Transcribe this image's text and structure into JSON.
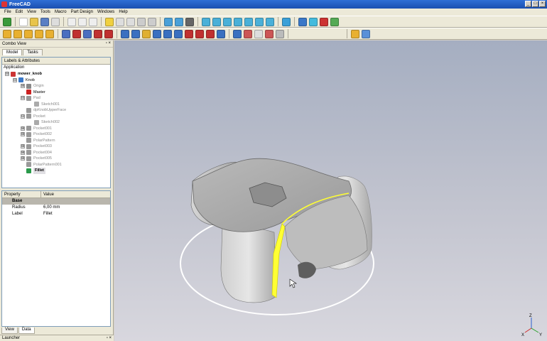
{
  "window": {
    "title": "FreeCAD",
    "buttons": [
      "_",
      "□",
      "×"
    ]
  },
  "menu": [
    "File",
    "Edit",
    "View",
    "Tools",
    "Macro",
    "Part Design",
    "Windows",
    "Help"
  ],
  "combo_view": {
    "title": "Combo View",
    "dock_buttons": "▫ ×",
    "tabs": [
      "Model",
      "Tasks"
    ],
    "labels_header": "Labels & Attributes",
    "section": "Application",
    "tree": [
      {
        "label": "mower_knob",
        "indent": 0,
        "expander": "⊟",
        "style": "bold",
        "icon_color": "#cc3333"
      },
      {
        "label": "Knob",
        "indent": 1,
        "expander": "⊟",
        "style": "normal",
        "icon_color": "#3a78c8"
      },
      {
        "label": "Origin",
        "indent": 2,
        "expander": "⊞",
        "style": "grey",
        "icon_color": "#888888"
      },
      {
        "label": "Master",
        "indent": 2,
        "expander": "",
        "style": "normal",
        "icon_color": "#cc2222"
      },
      {
        "label": "Pad",
        "indent": 2,
        "expander": "⊟",
        "style": "grey",
        "icon_color": "#999999"
      },
      {
        "label": "Sketch001",
        "indent": 3,
        "expander": "",
        "style": "grey",
        "icon_color": "#aaaaaa"
      },
      {
        "label": "dpKnobUpperFace",
        "indent": 2,
        "expander": "",
        "style": "grey",
        "icon_color": "#999999"
      },
      {
        "label": "Pocket",
        "indent": 2,
        "expander": "⊟",
        "style": "grey",
        "icon_color": "#999999"
      },
      {
        "label": "Sketch002",
        "indent": 3,
        "expander": "",
        "style": "grey",
        "icon_color": "#aaaaaa"
      },
      {
        "label": "Pocket001",
        "indent": 2,
        "expander": "⊞",
        "style": "grey",
        "icon_color": "#999999"
      },
      {
        "label": "Pocket002",
        "indent": 2,
        "expander": "⊞",
        "style": "grey",
        "icon_color": "#999999"
      },
      {
        "label": "PolarPattern",
        "indent": 2,
        "expander": "",
        "style": "grey",
        "icon_color": "#999999"
      },
      {
        "label": "Pocket003",
        "indent": 2,
        "expander": "⊞",
        "style": "grey",
        "icon_color": "#999999"
      },
      {
        "label": "Pocket004",
        "indent": 2,
        "expander": "⊞",
        "style": "grey",
        "icon_color": "#999999"
      },
      {
        "label": "Pocket005",
        "indent": 2,
        "expander": "⊞",
        "style": "grey",
        "icon_color": "#999999"
      },
      {
        "label": "PolarPattern001",
        "indent": 2,
        "expander": "",
        "style": "grey",
        "icon_color": "#999999"
      },
      {
        "label": "Fillet",
        "indent": 2,
        "expander": "",
        "style": "selected",
        "icon_color": "#2a9a4a"
      }
    ]
  },
  "properties": {
    "col_property": "Property",
    "col_value": "Value",
    "group": "Base",
    "rows": [
      {
        "name": "Radius",
        "value": "6,00 mm"
      },
      {
        "name": "Label",
        "value": "Fillet"
      }
    ]
  },
  "bottom_tabs": [
    "View",
    "Data"
  ],
  "launcher": {
    "title": "Launcher"
  },
  "viewport": {
    "axis_labels": [
      "Z",
      "X",
      "Y"
    ],
    "colors": {
      "body": "#c9c9c9",
      "highlight": "#ffff33",
      "edge": "#ffffff"
    }
  }
}
